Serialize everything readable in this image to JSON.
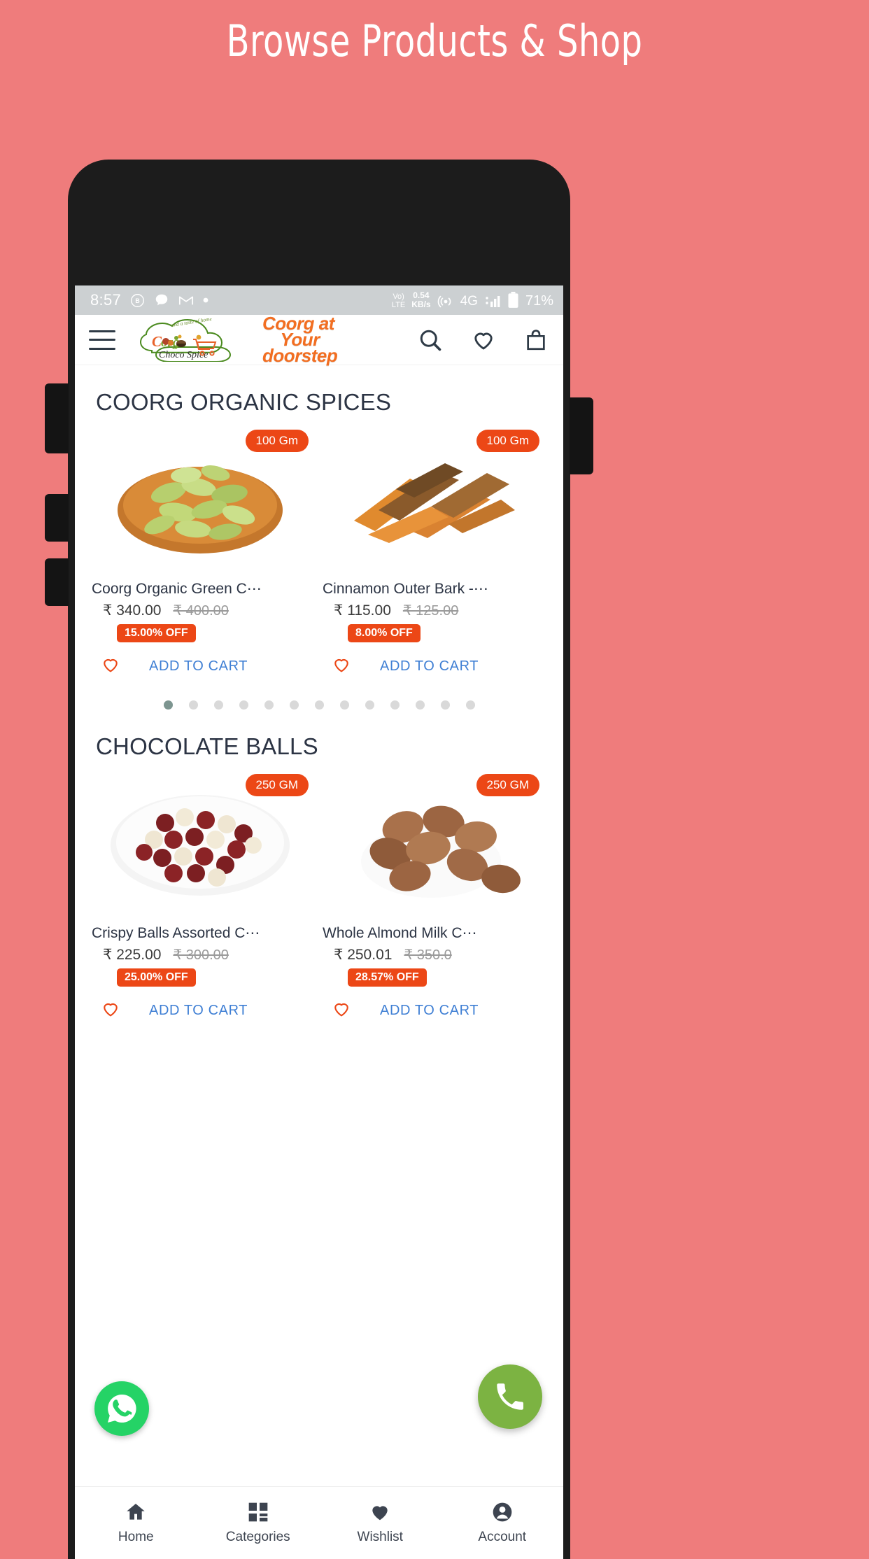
{
  "headline": "Browse Products & Shop",
  "theme": {
    "background": "#ef7c7c",
    "accent": "#EC4716",
    "brand_orange": "#F26E21",
    "link_blue": "#3f7fd4",
    "whatsapp_green": "#25D366",
    "call_green": "#7CB342"
  },
  "status_bar": {
    "time": "8:57",
    "left_icons": [
      "bitmoji-icon",
      "message-icon",
      "gmail-icon",
      "dot-icon"
    ],
    "network_label": "VoLTE",
    "volte_top": "Vo)",
    "volte_bottom": "LTE",
    "data_rate": "0.54",
    "data_unit": "KB/s",
    "hotspot_icon": "hotspot-icon",
    "network_type": "4G",
    "signal_icon": "signal-bars-icon",
    "battery_icon": "battery-icon",
    "battery_percent": "71%"
  },
  "appbar": {
    "menu_icon": "hamburger-menu-icon",
    "logo_primary": "Coorg",
    "logo_secondary": "Choco Spice",
    "logo_tagline": "and a taste of home",
    "brand_line1": "Coorg at",
    "brand_line2": "Your",
    "brand_line3": "doorstep",
    "search_icon": "search-icon",
    "wishlist_icon": "heart-icon",
    "cart_icon": "shopping-bag-icon"
  },
  "sections": [
    {
      "title": "COORG ORGANIC SPICES",
      "products": [
        {
          "name": "Coorg Organic Green C⋯",
          "weight": "100 Gm",
          "price": "₹ 340.00",
          "old_price": "₹ 400.00",
          "discount": "15.00% OFF",
          "wishlist_icon": "heart-outline-icon",
          "add_to_cart": "ADD TO CART",
          "image": "green-cardamom-bowl"
        },
        {
          "name": "Cinnamon Outer Bark -⋯",
          "weight": "100 Gm",
          "price": "₹ 115.00",
          "old_price": "₹ 125.00",
          "discount": "8.00% OFF",
          "wishlist_icon": "heart-outline-icon",
          "add_to_cart": "ADD TO CART",
          "image": "cinnamon-bark"
        }
      ],
      "pagination": {
        "total": 13,
        "active_index": 0
      }
    },
    {
      "title": "CHOCOLATE BALLS",
      "products": [
        {
          "name": "Crispy Balls Assorted C⋯",
          "weight": "250 GM",
          "price": "₹ 225.00",
          "old_price": "₹ 300.00",
          "discount": "25.00% OFF",
          "wishlist_icon": "heart-outline-icon",
          "add_to_cart": "ADD TO CART",
          "image": "assorted-crispy-balls"
        },
        {
          "name": "Whole Almond Milk C⋯",
          "weight": "250 GM",
          "price": "₹ 250.01",
          "old_price": "₹ 350.0",
          "discount": "28.57% OFF",
          "wishlist_icon": "heart-outline-icon",
          "add_to_cart": "ADD TO CART",
          "image": "almond-milk-chocolate-balls"
        }
      ]
    }
  ],
  "floating": {
    "whatsapp": "whatsapp-icon",
    "call": "phone-call-icon"
  },
  "bottom_nav": [
    {
      "label": "Home",
      "icon": "home-icon",
      "active": true
    },
    {
      "label": "Categories",
      "icon": "grid-icon",
      "active": false
    },
    {
      "label": "Wishlist",
      "icon": "heart-filled-icon",
      "active": false
    },
    {
      "label": "Account",
      "icon": "account-icon",
      "active": false
    }
  ]
}
